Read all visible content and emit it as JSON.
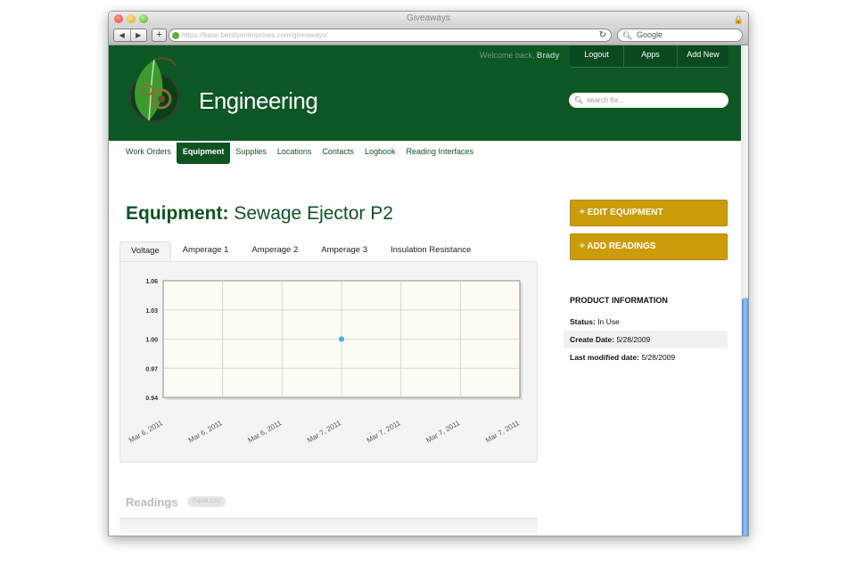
{
  "browser": {
    "title": "Giveaways",
    "url": "https://base.bentlyenterprises.com/giveaways/",
    "search_placeholder": "Google"
  },
  "header": {
    "brand": "Engineering",
    "welcome_prefix": "Welcome back, ",
    "welcome_user": "Brady",
    "top_buttons": [
      "Logout",
      "Apps",
      "Add New"
    ],
    "search_placeholder": "search for..."
  },
  "nav": {
    "items": [
      "Work Orders",
      "Equipment",
      "Supplies",
      "Locations",
      "Contacts",
      "Logbook",
      "Reading Interfaces"
    ],
    "active": "Equipment"
  },
  "page": {
    "title_label": "Equipment:",
    "title_value": "Sewage Ejector P2"
  },
  "tabs": {
    "items": [
      "Voltage",
      "Amperage 1",
      "Amperage 2",
      "Amperage 3",
      "Insulation Resistance"
    ],
    "active": "Voltage"
  },
  "chart_data": {
    "type": "scatter",
    "title": "",
    "xlabel": "",
    "ylabel": "",
    "x_ticks": [
      "Mar 6, 2011",
      "Mar 6, 2011",
      "Mar 6, 2011",
      "Mar 7, 2011",
      "Mar 7, 2011",
      "Mar 7, 2011",
      "Mar 7, 2011"
    ],
    "y_ticks": [
      "1.06",
      "1.03",
      "1.00",
      "0.97",
      "0.94"
    ],
    "ylim": [
      0.94,
      1.06
    ],
    "points": [
      {
        "x_index": 3,
        "y": 1.0
      }
    ],
    "point_color": "#4bb3c9",
    "grid": true
  },
  "sidebar": {
    "edit_button": "+ EDIT EQUIPMENT",
    "add_button": "+ ADD READINGS",
    "info_title": "PRODUCT INFORMATION",
    "status_label": "Status:",
    "status_value": "In Use",
    "create_label": "Create Date:",
    "create_value": "5/28/2009",
    "modified_label": "Last modified date:",
    "modified_value": "5/28/2009"
  },
  "readings": {
    "title": "Readings",
    "export_label": "Export CSV"
  },
  "colors": {
    "brand_green": "#0d5725",
    "accent_gold": "#cd9c0c"
  }
}
